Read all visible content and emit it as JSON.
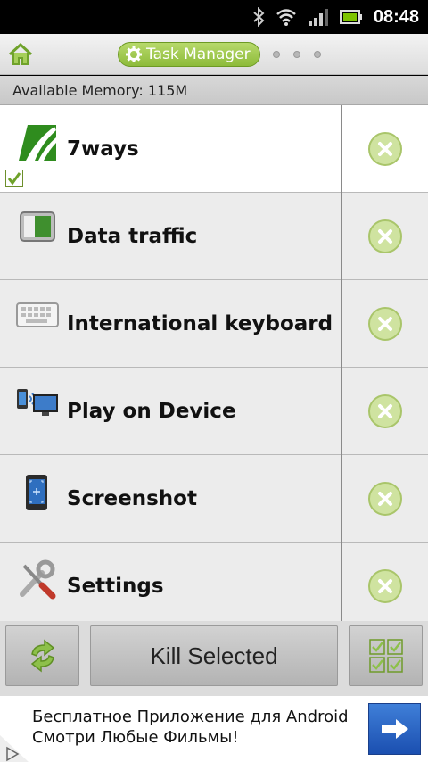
{
  "status_bar": {
    "time": "08:48"
  },
  "header": {
    "title": "Task Manager",
    "page_count": 3
  },
  "memory": {
    "text": "Available Memory: 115M"
  },
  "tasks": [
    {
      "label": "7ways",
      "icon": "7ways-app-icon",
      "selected": true
    },
    {
      "label": "Data traffic",
      "icon": "data-traffic-icon",
      "selected": false
    },
    {
      "label": "International keyboard",
      "icon": "keyboard-icon",
      "selected": false
    },
    {
      "label": "Play on Device",
      "icon": "play-on-device-icon",
      "selected": false
    },
    {
      "label": "Screenshot",
      "icon": "screenshot-icon",
      "selected": false
    },
    {
      "label": "Settings",
      "icon": "settings-icon",
      "selected": false
    }
  ],
  "toolbar": {
    "kill_selected_label": "Kill Selected"
  },
  "ad": {
    "line1": "Бесплатное Приложение для Android",
    "line2": "Смотри Любые Фильмы!"
  },
  "colors": {
    "accent_green": "#8dbb3a",
    "kill_button": "#cfe3a0",
    "ad_button": "#2f66c5"
  }
}
